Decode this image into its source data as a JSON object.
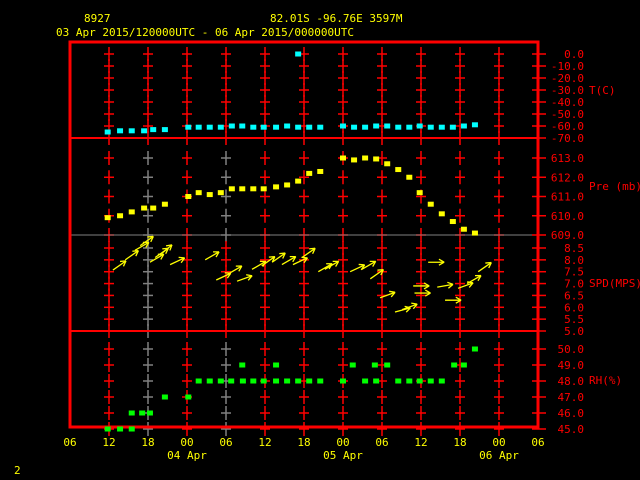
{
  "header": {
    "station": "8927",
    "location": "82.01S  -96.76E  3597M",
    "period": "03 Apr 2015/120000UTC - 06 Apr 2015/000000UTC"
  },
  "page_number": "2",
  "colors": {
    "frame": "#ff0000",
    "text": "#ffff00",
    "temp": "#00ffff",
    "pres": "#ffff00",
    "wind": "#ffff00",
    "rh": "#00ff00",
    "grid_gray": "#808080"
  },
  "x_axis": {
    "hour_labels": [
      "06",
      "12",
      "18",
      "00",
      "06",
      "12",
      "18",
      "00",
      "06",
      "12",
      "18",
      "00",
      "06"
    ],
    "date_labels": [
      {
        "label": "04 Apr",
        "hour": 18
      },
      {
        "label": "05 Apr",
        "hour": 42
      },
      {
        "label": "06 Apr",
        "hour": 66
      }
    ],
    "range_hours": [
      0,
      72
    ],
    "origin": "03 Apr 2015 06UTC"
  },
  "chart_data": [
    {
      "type": "scatter",
      "title": "T(C)",
      "ylim": [
        -70,
        0
      ],
      "y_ticks": [
        "0.0",
        "-10.0",
        "-20.0",
        "-30.0",
        "-40.0",
        "-50.0",
        "-60.0",
        "-70.0"
      ],
      "y_tick_values": [
        0,
        -10,
        -20,
        -30,
        -40,
        -50,
        -60,
        -70
      ],
      "x": [
        5.8,
        7.7,
        9.5,
        11.4,
        12.8,
        14.6,
        18.2,
        19.8,
        21.5,
        23.2,
        24.9,
        26.5,
        28.2,
        29.8,
        31.7,
        33.4,
        35.1,
        36.8,
        38.5,
        42.0,
        43.7,
        45.4,
        47.1,
        48.8,
        50.5,
        52.2,
        53.8,
        55.5,
        57.2,
        58.9,
        60.6,
        62.3,
        35.1
      ],
      "values": [
        -65,
        -64,
        -64,
        -64,
        -63,
        -63,
        -61,
        -61,
        -61,
        -61,
        -60,
        -60,
        -61,
        -61,
        -61,
        -60,
        -61,
        -61,
        -61,
        -60,
        -61,
        -61,
        -60,
        -60,
        -61,
        -61,
        -60,
        -61,
        -61,
        -61,
        -60,
        -59,
        0
      ]
    },
    {
      "type": "scatter",
      "title": "Pre (mb)",
      "ylim": [
        609,
        613
      ],
      "y_ticks": [
        "613.0",
        "612.0",
        "611.0",
        "610.0",
        "609.0"
      ],
      "y_tick_values": [
        613,
        612,
        611,
        610,
        609
      ],
      "x": [
        5.8,
        7.7,
        9.5,
        11.4,
        12.8,
        14.6,
        18.2,
        19.8,
        21.5,
        23.2,
        24.9,
        26.5,
        28.2,
        29.8,
        31.7,
        33.4,
        35.1,
        36.8,
        38.5,
        42.0,
        43.7,
        45.4,
        47.1,
        48.8,
        50.5,
        52.2,
        53.8,
        55.5,
        57.2,
        58.9,
        60.6,
        62.3
      ],
      "values": [
        609.9,
        610.0,
        610.2,
        610.4,
        610.4,
        610.6,
        611.0,
        611.2,
        611.1,
        611.2,
        611.4,
        611.4,
        611.4,
        611.4,
        611.5,
        611.6,
        611.8,
        612.2,
        612.3,
        613.0,
        612.9,
        613.0,
        612.95,
        612.7,
        612.4,
        612.0,
        611.2,
        610.6,
        610.1,
        609.7,
        609.3,
        609.1
      ]
    },
    {
      "type": "vector",
      "title": "SPD(MPS)",
      "ylim": [
        5.0,
        8.5
      ],
      "y_ticks": [
        "8.5",
        "8.0",
        "7.5",
        "7.0",
        "6.5",
        "6.0",
        "5.5",
        "5.0"
      ],
      "y_tick_values": [
        8.5,
        8.0,
        7.5,
        7.0,
        6.5,
        6.0,
        5.5,
        5.0
      ],
      "x": [
        6.6,
        8.5,
        10.0,
        10.8,
        12.3,
        13.1,
        13.8,
        15.4,
        20.8,
        22.5,
        24.3,
        25.7,
        28.0,
        29.5,
        31.1,
        32.6,
        34.3,
        35.7,
        38.2,
        39.2,
        43.1,
        44.9,
        46.2,
        47.7,
        50.0,
        51.1,
        55.1,
        52.8,
        53.0,
        56.5,
        57.7,
        59.7,
        61.1,
        62.8
      ],
      "values": [
        7.57,
        8.0,
        8.4,
        8.6,
        7.9,
        8.1,
        8.2,
        7.8,
        8.0,
        7.15,
        7.4,
        7.1,
        7.6,
        7.75,
        7.9,
        7.8,
        7.8,
        8.1,
        7.5,
        7.6,
        7.5,
        7.6,
        7.2,
        6.4,
        5.8,
        5.9,
        7.9,
        6.9,
        6.6,
        6.85,
        6.3,
        6.8,
        7.0,
        7.5
      ],
      "direction_deg": [
        35,
        35,
        30,
        35,
        30,
        35,
        40,
        25,
        30,
        25,
        30,
        20,
        30,
        35,
        35,
        30,
        25,
        35,
        30,
        30,
        25,
        30,
        35,
        20,
        15,
        20,
        0,
        0,
        0,
        10,
        0,
        20,
        30,
        35
      ]
    },
    {
      "type": "scatter",
      "title": "RH(%)",
      "ylim": [
        45,
        50
      ],
      "y_ticks": [
        "50.0",
        "49.0",
        "48.0",
        "47.0",
        "46.0",
        "45.0"
      ],
      "y_tick_values": [
        50,
        49,
        48,
        47,
        46,
        45
      ],
      "x": [
        5.8,
        7.7,
        9.5,
        9.5,
        11.1,
        12.3,
        14.6,
        18.2,
        19.8,
        21.5,
        23.2,
        24.8,
        26.6,
        26.5,
        28.2,
        29.8,
        31.7,
        31.7,
        33.4,
        35.1,
        36.8,
        38.5,
        42.0,
        43.5,
        45.4,
        46.9,
        47.1,
        48.8,
        50.5,
        52.2,
        53.8,
        55.5,
        57.2,
        59.1,
        60.6,
        62.3
      ],
      "values": [
        45,
        45,
        45,
        46,
        46,
        46,
        47,
        47,
        48,
        48,
        48,
        48,
        48,
        49,
        48,
        48,
        48,
        49,
        48,
        48,
        48,
        48,
        48,
        49,
        48,
        49,
        48,
        49,
        48,
        48,
        48,
        48,
        48,
        49,
        49,
        50
      ]
    }
  ]
}
